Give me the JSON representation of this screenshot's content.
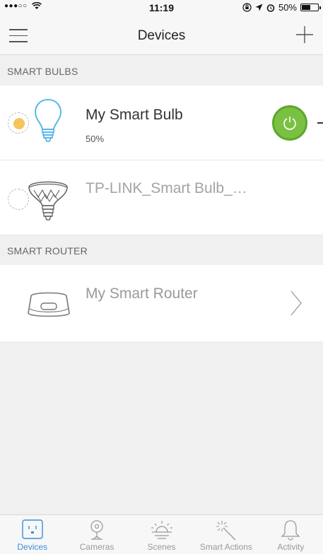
{
  "status_bar": {
    "signal": "●●●○○",
    "time": "11:19",
    "battery": "50%"
  },
  "nav": {
    "title": "Devices"
  },
  "sections": {
    "bulbs_header": "SMART BULBS",
    "router_header": "SMART ROUTER"
  },
  "devices": [
    {
      "name": "My Smart Bulb",
      "status": "50%",
      "power": "on"
    },
    {
      "name": "TP-LINK_Smart Bulb_…"
    },
    {
      "name": "My Smart Router"
    }
  ],
  "tabs": [
    {
      "label": "Devices",
      "active": true
    },
    {
      "label": "Cameras"
    },
    {
      "label": "Scenes"
    },
    {
      "label": "Smart Actions"
    },
    {
      "label": "Activity"
    }
  ],
  "colors": {
    "accent": "#3a8edc",
    "power_on": "#7ac142",
    "bulb_blue": "#5ab7e8",
    "bulb_glow": "#f5c55a"
  }
}
